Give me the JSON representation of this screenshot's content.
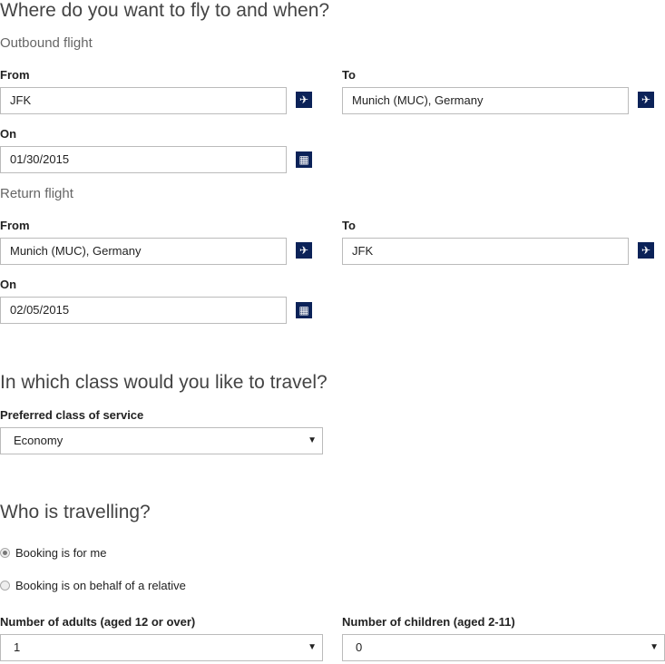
{
  "flight": {
    "heading": "Where do you want to fly to and when?",
    "outbound": {
      "title": "Outbound flight",
      "from_label": "From",
      "from": "JFK",
      "to_label": "To",
      "to": "Munich (MUC), Germany",
      "on_label": "On",
      "date": "01/30/2015"
    },
    "return": {
      "title": "Return flight",
      "from_label": "From",
      "from": "Munich (MUC), Germany",
      "to_label": "To",
      "to": "JFK",
      "on_label": "On",
      "date": "02/05/2015"
    }
  },
  "class": {
    "heading": "In which class would you like to travel?",
    "label": "Preferred class of service",
    "value": "Economy"
  },
  "travellers": {
    "heading": "Who is travelling?",
    "options": [
      {
        "label": "Booking is for me",
        "selected": true
      },
      {
        "label": "Booking is on behalf of a relative",
        "selected": false
      }
    ],
    "adults_label": "Number of adults (aged 12 or over)",
    "adults": "1",
    "children_label": "Number of children (aged 2-11)",
    "children": "0"
  },
  "icons": {
    "plane": "✈",
    "calendar": "▦",
    "arrow": "▼"
  },
  "colors": {
    "button": "#0b2258"
  }
}
